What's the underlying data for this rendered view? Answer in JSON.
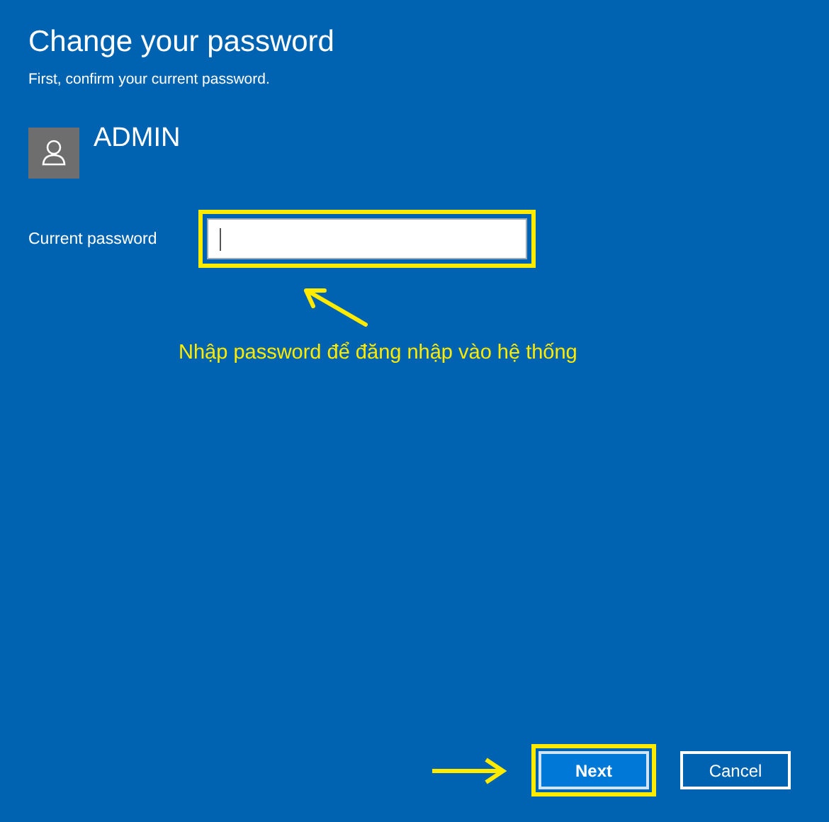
{
  "dialog": {
    "title": "Change your password",
    "subtitle": "First, confirm your current password."
  },
  "user": {
    "name": "ADMIN"
  },
  "password_field": {
    "label": "Current password",
    "highlighted": true,
    "focused": true
  },
  "annotation": {
    "text": "Nhập password để đăng nhập vào hệ thống"
  },
  "buttons": [
    {
      "label": "Next",
      "kind": "primary",
      "highlighted": true
    },
    {
      "label": "Cancel",
      "kind": "secondary",
      "highlighted": false
    }
  ]
}
